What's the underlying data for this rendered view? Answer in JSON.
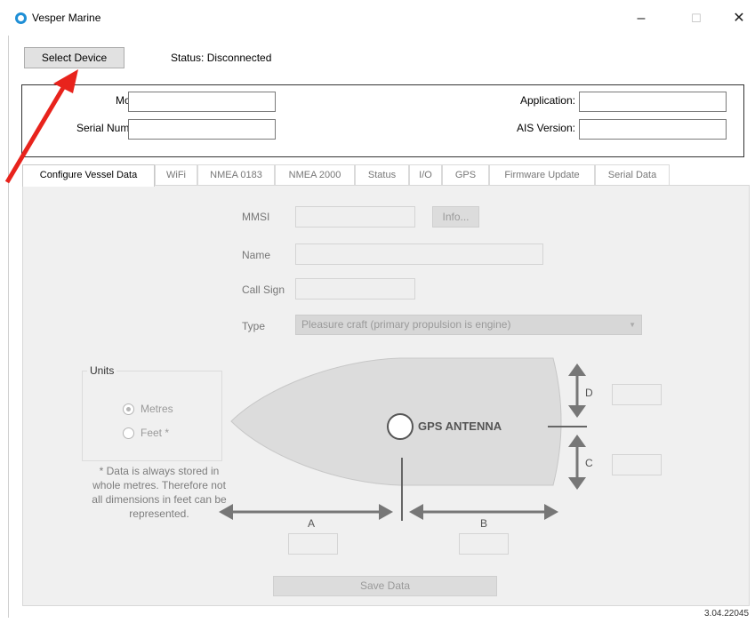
{
  "window": {
    "title": "Vesper Marine",
    "minimize": "–",
    "maximize": "☐",
    "close": "✕"
  },
  "toolbar": {
    "select_device": "Select Device",
    "status": "Status:  Disconnected"
  },
  "device_info": {
    "model_label": "Model:",
    "serial_label": "Serial Number:",
    "application_label": "Application:",
    "ais_version_label": "AIS Version:",
    "model": "",
    "serial": "",
    "application": "",
    "ais_version": ""
  },
  "tabs": [
    {
      "label": "Configure Vessel Data"
    },
    {
      "label": "WiFi"
    },
    {
      "label": "NMEA 0183"
    },
    {
      "label": "NMEA 2000"
    },
    {
      "label": "Status"
    },
    {
      "label": "I/O"
    },
    {
      "label": "GPS"
    },
    {
      "label": "Firmware Update"
    },
    {
      "label": "Serial Data"
    }
  ],
  "vessel": {
    "mmsi_label": "MMSI",
    "info_button": "Info...",
    "name_label": "Name",
    "callsign_label": "Call Sign",
    "type_label": "Type",
    "type_value": "Pleasure craft (primary propulsion is engine)",
    "mmsi": "",
    "name": "",
    "callsign": ""
  },
  "units": {
    "legend": "Units",
    "metres": "Metres",
    "feet": "Feet *",
    "note": "* Data is always stored in whole metres. Therefore not all dimensions in feet can be represented."
  },
  "diagram": {
    "gps_label": "GPS ANTENNA",
    "dim_a": "A",
    "dim_b": "B",
    "dim_c": "C",
    "dim_d": "D"
  },
  "save_button": "Save Data",
  "version": "3.04.22045",
  "colors": {
    "accent_arrow": "#e8231c",
    "app_icon": "#1f8fd6",
    "hull": "#dcdcdc"
  },
  "icons": {
    "app": "vesper-logo-icon",
    "annotation": "red-arrow-icon"
  }
}
